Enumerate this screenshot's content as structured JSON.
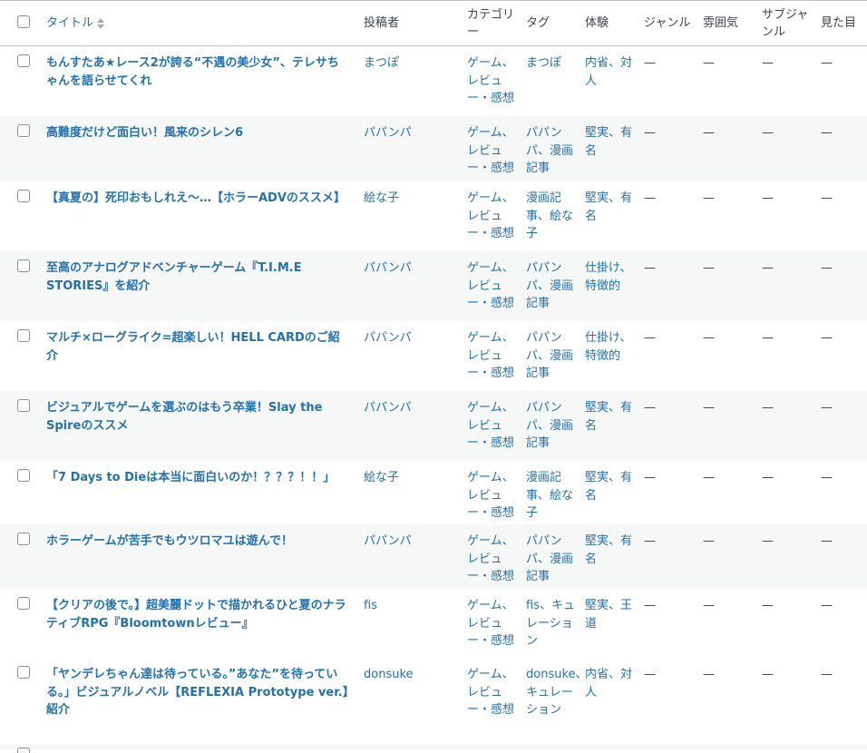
{
  "header": {
    "title": "タイトル",
    "author": "投稿者",
    "category": "カテゴリー",
    "tag": "タグ",
    "experience": "体験",
    "genre": "ジャンル",
    "mood": "雰囲気",
    "subgenre": "サブジャンル",
    "look": "見た目"
  },
  "posts": [
    {
      "title": "もんすたあ★レース2が誇る“不遇の美少女”、テレサちゃんを語らせてくれ",
      "author": "まつぽ",
      "category": "ゲーム、レビュー・感想",
      "tag": "まつぽ",
      "experience": "内省、対人",
      "genre": "—",
      "mood": "—",
      "subgenre": "—",
      "look": "—"
    },
    {
      "title": "高難度だけど面白い！風来のシレン6",
      "author": "パパンパ",
      "category": "ゲーム、レビュー・感想",
      "tag": "パパンパ、漫画記事",
      "experience": "堅実、有名",
      "genre": "—",
      "mood": "—",
      "subgenre": "—",
      "look": "—"
    },
    {
      "title": "【真夏の】死印おもしれえ～…【ホラーADVのススメ】",
      "author": "絵な子",
      "category": "ゲーム、レビュー・感想",
      "tag": "漫画記事、絵な子",
      "experience": "堅実、有名",
      "genre": "—",
      "mood": "—",
      "subgenre": "—",
      "look": "—"
    },
    {
      "title": "至高のアナログアドベンチャーゲーム『T.I.M.E STORIES』を紹介",
      "author": "パパンパ",
      "category": "ゲーム、レビュー・感想",
      "tag": "パパンパ、漫画記事",
      "experience": "仕掛け、特徴的",
      "genre": "—",
      "mood": "—",
      "subgenre": "—",
      "look": "—"
    },
    {
      "title": "マルチ×ローグライク=超楽しい！HELL CARDのご紹介",
      "author": "パパンパ",
      "category": "ゲーム、レビュー・感想",
      "tag": "パパンパ、漫画記事",
      "experience": "仕掛け、特徴的",
      "genre": "—",
      "mood": "—",
      "subgenre": "—",
      "look": "—"
    },
    {
      "title": "ビジュアルでゲームを選ぶのはもう卒業！Slay the Spireのススメ",
      "author": "パパンパ",
      "category": "ゲーム、レビュー・感想",
      "tag": "パパンパ、漫画記事",
      "experience": "堅実、有名",
      "genre": "—",
      "mood": "—",
      "subgenre": "—",
      "look": "—"
    },
    {
      "title": "「7 Days to Dieは本当に面白いのか！？？？！！」",
      "author": "絵な子",
      "category": "ゲーム、レビュー・感想",
      "tag": "漫画記事、絵な子",
      "experience": "堅実、有名",
      "genre": "—",
      "mood": "—",
      "subgenre": "—",
      "look": "—"
    },
    {
      "title": "ホラーゲームが苦手でもウツロマユは遊んで！",
      "author": "パパンパ",
      "category": "ゲーム、レビュー・感想",
      "tag": "パパンパ、漫画記事",
      "experience": "堅実、有名",
      "genre": "—",
      "mood": "—",
      "subgenre": "—",
      "look": "—"
    },
    {
      "title": "【クリアの後で。】超美麗ドットで描かれるひと夏のナラティブRPG『Bloomtownレビュー』",
      "author": "fis",
      "category": "ゲーム、レビュー・感想",
      "tag": "fis、キュレーション",
      "experience": "堅実、王道",
      "genre": "—",
      "mood": "—",
      "subgenre": "—",
      "look": "—"
    },
    {
      "title": "「ヤンデレちゃん達は待っている。”あなた”を待っている。」ビジュアルノベル【REFLEXIA Prototype ver.】紹介",
      "author": "donsuke",
      "category": "ゲーム、レビュー・感想",
      "tag": "donsuke、キュレーション",
      "experience": "内省、対人",
      "genre": "—",
      "mood": "—",
      "subgenre": "—",
      "look": "—"
    }
  ],
  "colors": {
    "link": "#2271b1",
    "text": "#3c434a",
    "stripe": "#f6f7f7",
    "border": "#c3c4c7"
  }
}
